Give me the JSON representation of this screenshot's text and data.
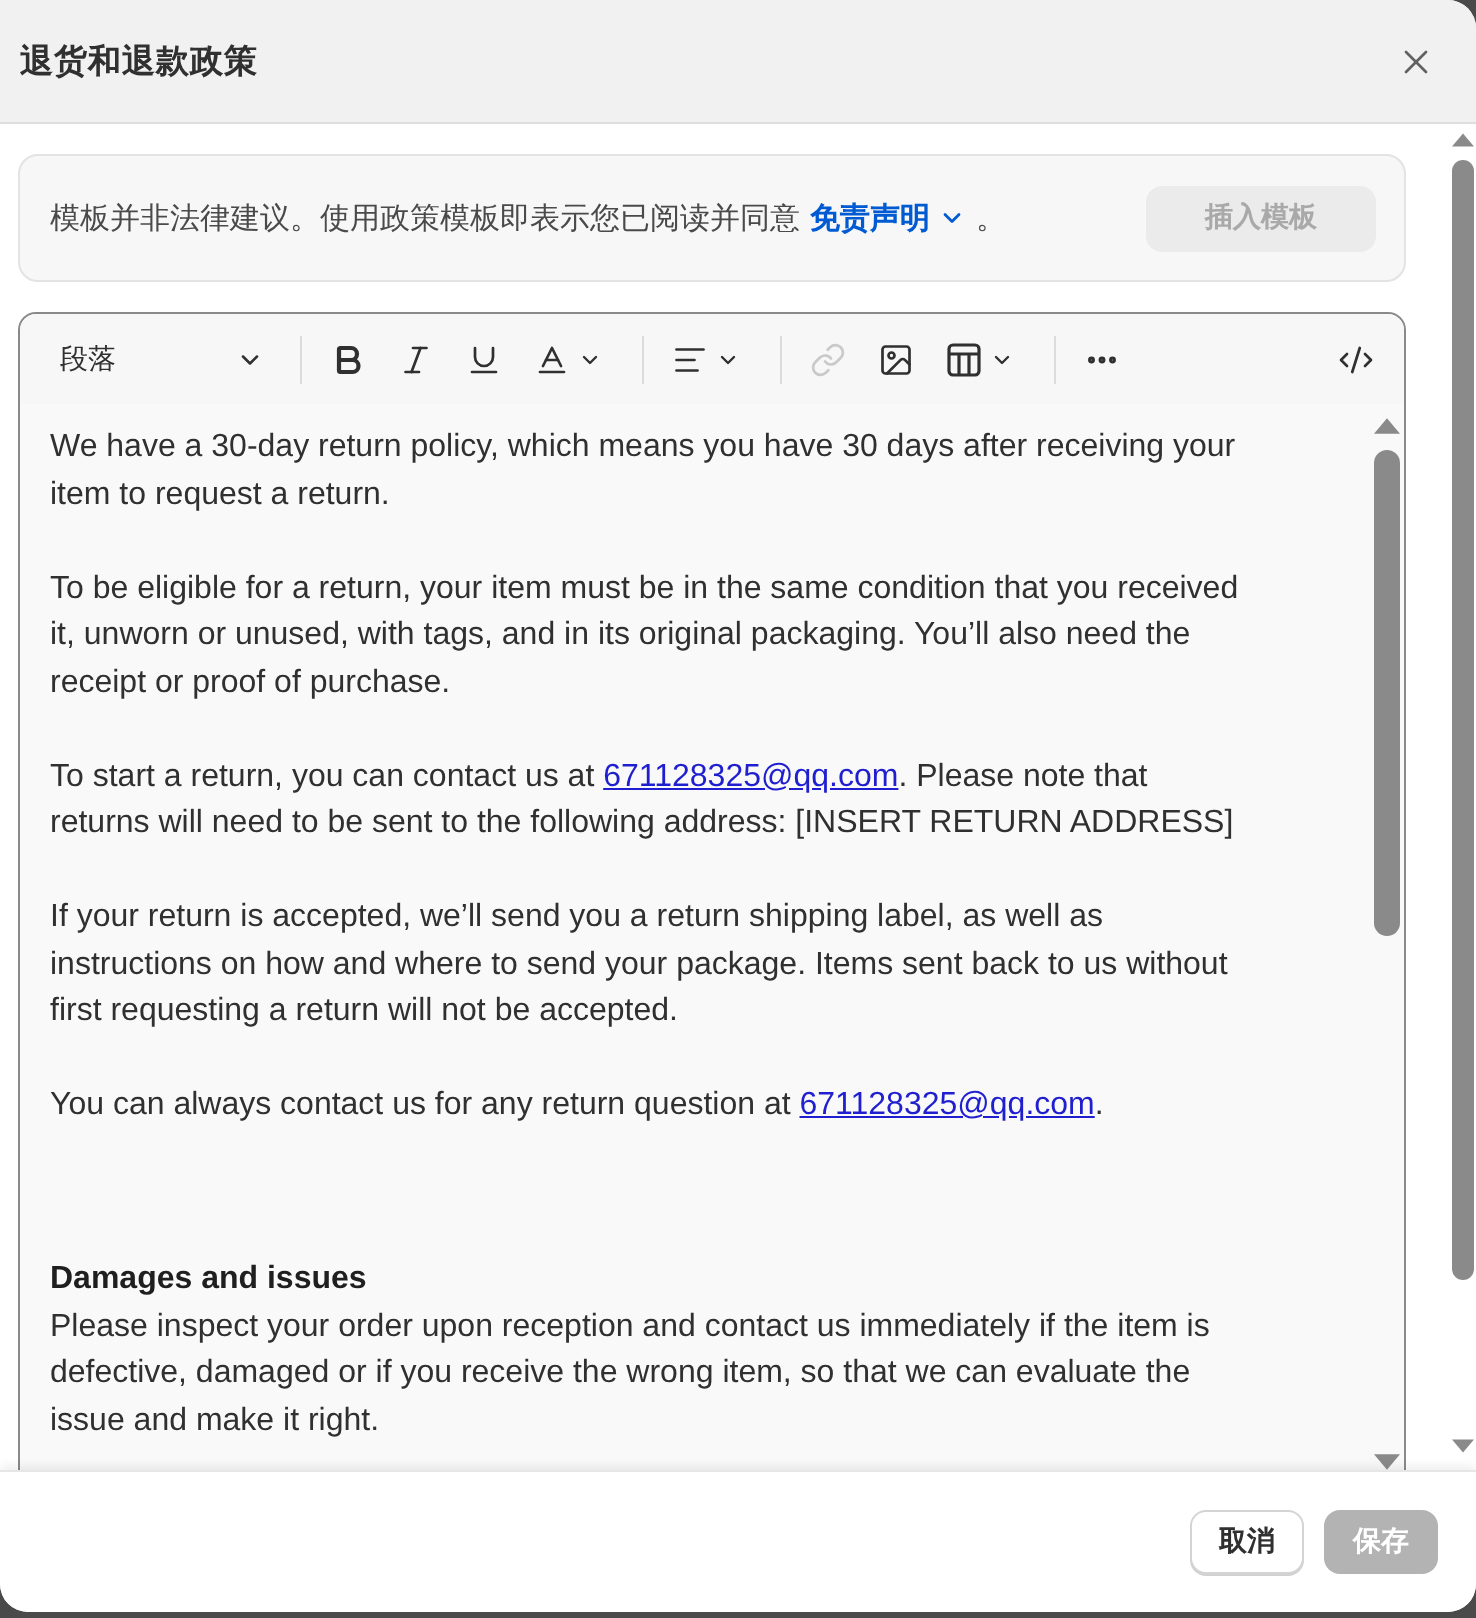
{
  "dialog": {
    "title": "退货和退款政策"
  },
  "notice": {
    "text": "模板并非法律建议。使用政策模板即表示您已阅读并同意",
    "link": "免责声明",
    "suffix": "。",
    "button": {
      "label": "插入模板",
      "disabled": true
    }
  },
  "toolbar": {
    "format": {
      "label": "段落"
    },
    "groups": [
      [
        {
          "kind": "bold",
          "menu": false,
          "disabled": false
        },
        {
          "kind": "italic",
          "menu": false,
          "disabled": false
        },
        {
          "kind": "underline",
          "menu": false,
          "disabled": false
        },
        {
          "kind": "text_color",
          "menu": true,
          "disabled": false
        }
      ],
      [
        {
          "kind": "align",
          "menu": true,
          "disabled": false
        }
      ],
      [
        {
          "kind": "link",
          "menu": false,
          "disabled": true
        },
        {
          "kind": "image",
          "menu": false,
          "disabled": false
        },
        {
          "kind": "table",
          "menu": true,
          "disabled": false
        }
      ],
      [
        {
          "kind": "more",
          "menu": false,
          "disabled": false
        }
      ]
    ],
    "trailing": [
      {
        "kind": "code",
        "menu": false,
        "disabled": false
      }
    ]
  },
  "content": [
    {
      "kind": "paragraph",
      "parts": [
        {
          "kind": "text",
          "text": "We have a 30-day return policy, which means you have 30 days after receiving your item to request a return."
        }
      ]
    },
    {
      "kind": "paragraph",
      "parts": [
        {
          "kind": "text",
          "text": "To be eligible for a return, your item must be in the same condition that you received it, unworn or unused, with tags, and in its original packaging. You’ll also need the receipt or proof of purchase."
        }
      ]
    },
    {
      "kind": "paragraph",
      "parts": [
        {
          "kind": "text",
          "text": "To start a return, you can contact us at "
        },
        {
          "kind": "link",
          "text": "671128325@qq.com"
        },
        {
          "kind": "text",
          "text": ". Please note that returns will need to be sent to the following address: [INSERT RETURN ADDRESS]"
        }
      ]
    },
    {
      "kind": "paragraph",
      "parts": [
        {
          "kind": "text",
          "text": "If your return is accepted, we’ll send you a return shipping label, as well as instructions on how and where to send your package. Items sent back to us without first requesting a return will not be accepted."
        }
      ]
    },
    {
      "kind": "paragraph",
      "parts": [
        {
          "kind": "text",
          "text": "You can always contact us for any return question at "
        },
        {
          "kind": "link",
          "text": "671128325@qq.com"
        },
        {
          "kind": "text",
          "text": "."
        }
      ]
    },
    {
      "kind": "heading",
      "parts": [
        {
          "kind": "text",
          "text": "Damages and issues"
        }
      ]
    },
    {
      "kind": "paragraph",
      "parts": [
        {
          "kind": "text",
          "text": "Please inspect your order upon reception and contact us immediately if the item is defective, damaged or if you receive the wrong item, so that we can evaluate the issue and make it right."
        }
      ]
    }
  ],
  "footer": {
    "buttons": [
      {
        "label": "取消",
        "kind": "secondary",
        "disabled": false
      },
      {
        "label": "保存",
        "kind": "primary",
        "disabled": true
      }
    ]
  }
}
